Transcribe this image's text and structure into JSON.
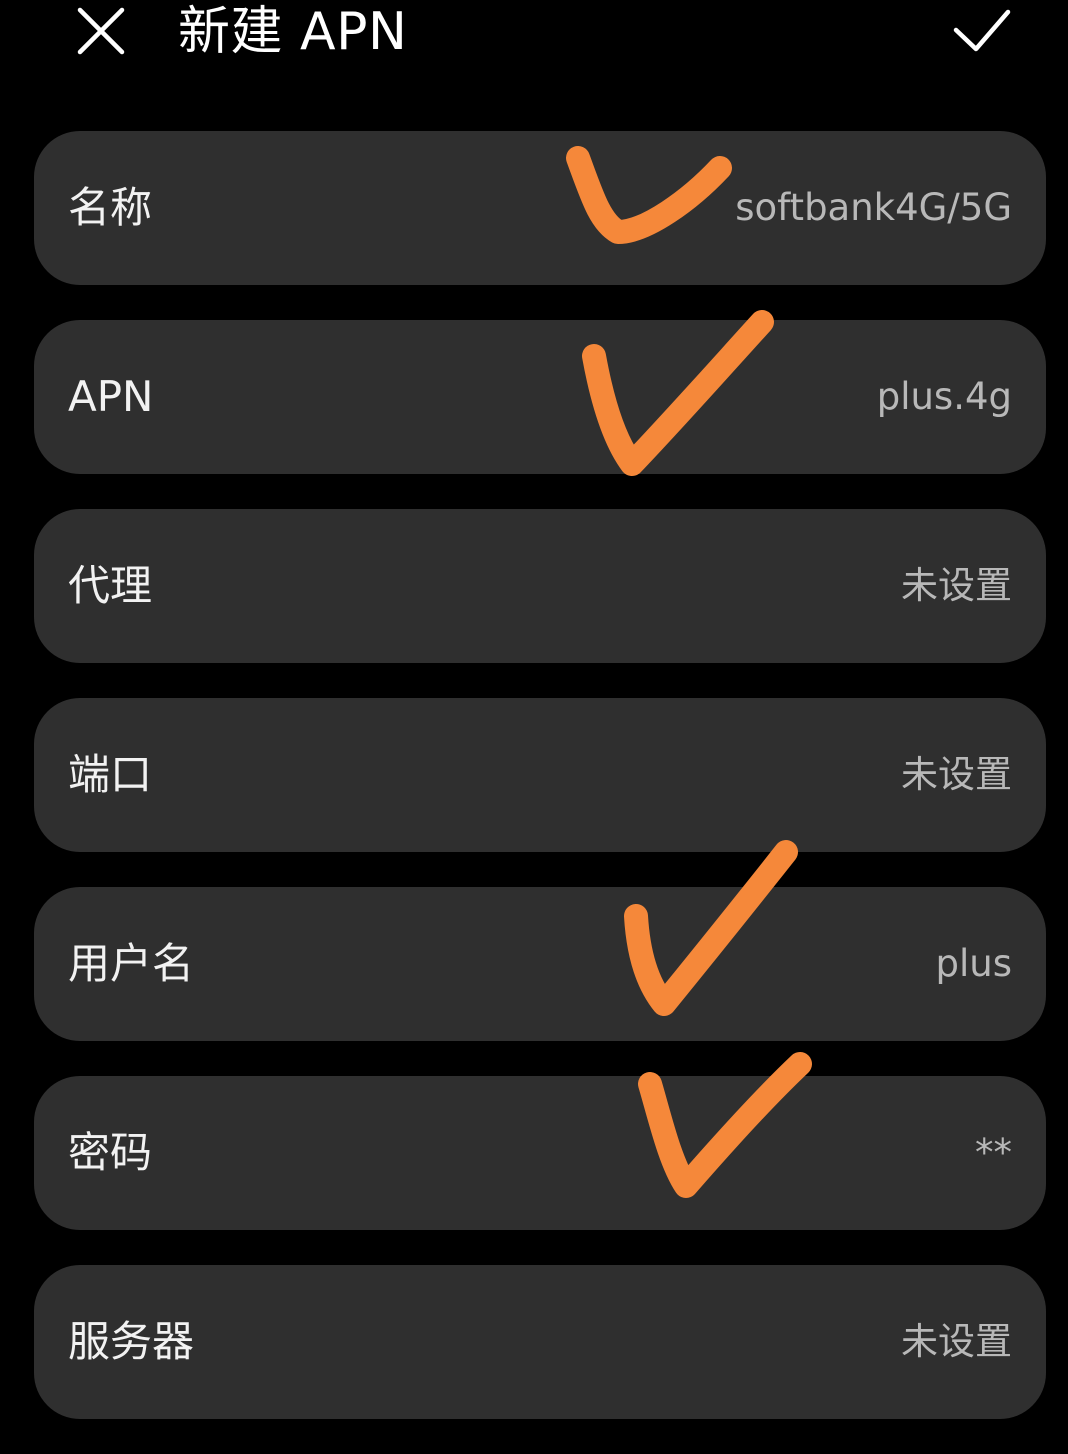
{
  "header": {
    "title": "新建 APN",
    "close_icon": "close-icon",
    "confirm_icon": "checkmark-icon"
  },
  "fields": [
    {
      "label": "名称",
      "value": "softbank4G/5G"
    },
    {
      "label": "APN",
      "value": "plus.4g"
    },
    {
      "label": "代理",
      "value": "未设置"
    },
    {
      "label": "端口",
      "value": "未设置"
    },
    {
      "label": "用户名",
      "value": "plus"
    },
    {
      "label": "密码",
      "value": "**"
    },
    {
      "label": "服务器",
      "value": "未设置"
    }
  ],
  "annotation_color": "#f5883a",
  "colors": {
    "background": "#000000",
    "row_background": "#2f2f2f",
    "label_text": "#f2f2f2",
    "value_text": "#b8b8b8"
  }
}
